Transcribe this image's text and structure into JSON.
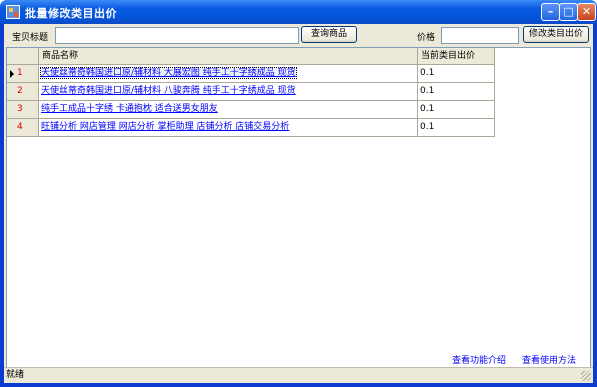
{
  "window": {
    "title": "批量修改类目出价"
  },
  "toolbar": {
    "title_label": "宝贝标题",
    "title_value": "",
    "query_button": "查询商品",
    "price_label": "价格",
    "price_value": "",
    "modify_button": "修改类目出价"
  },
  "grid": {
    "columns": [
      "商品名称",
      "当前类目出价"
    ],
    "rows": [
      {
        "num": "1",
        "name": "天使丝蒂奇韩国进口原/辅材料 大展宏图 纯手工十字绣成品 现货",
        "price": "0.1"
      },
      {
        "num": "2",
        "name": "天使丝蒂奇韩国进口原/辅材料 八骏奔腾 纯手工十字绣成品 现货",
        "price": "0.1"
      },
      {
        "num": "3",
        "name": "纯手工成品十字绣 卡通抱枕 适合送男女朋友",
        "price": "0.1"
      },
      {
        "num": "4",
        "name": "旺铺分析 网店管理 网店分析 掌柜助理 店铺分析 店铺交易分析",
        "price": "0.1"
      }
    ]
  },
  "links": {
    "features": "查看功能介绍",
    "usage": "查看使用方法"
  },
  "status": {
    "text": "就绪"
  }
}
